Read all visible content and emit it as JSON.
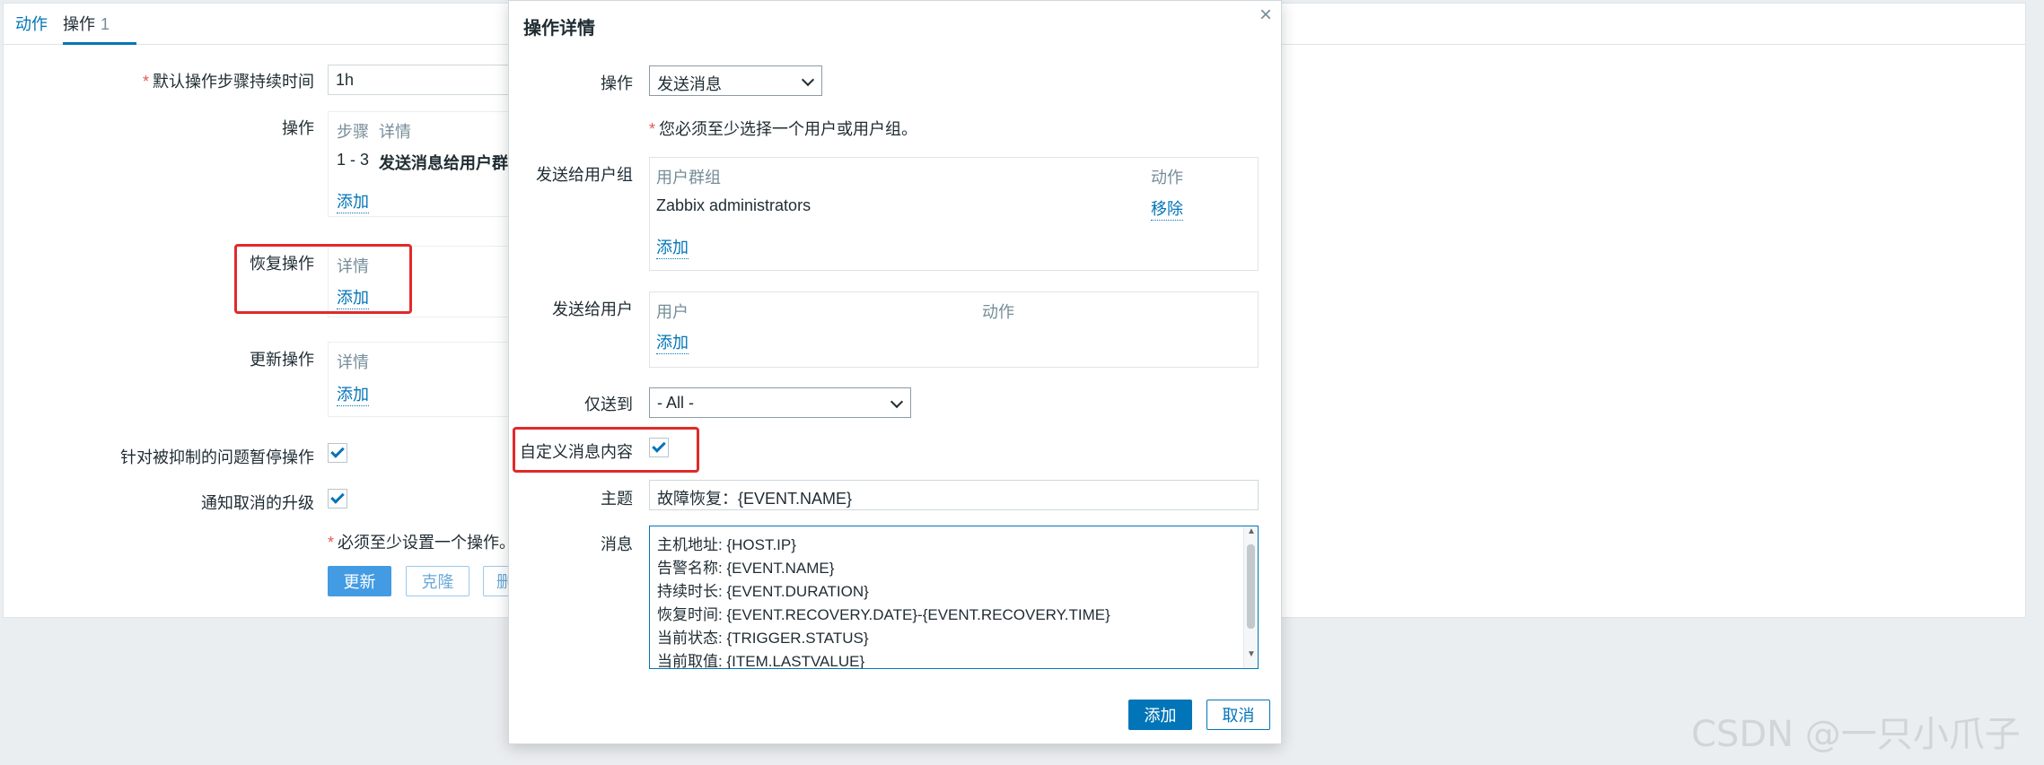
{
  "tabs": {
    "actions": "动作",
    "operations": "操作",
    "operations_count": "1"
  },
  "form": {
    "default_duration_label": "默认操作步骤持续时间",
    "default_duration_value": "1h",
    "operations_label": "操作",
    "operations_header_steps": "步骤",
    "operations_header_details": "详情",
    "operations_row_steps": "1 - 3",
    "operations_row_details": "发送消息给用户群",
    "add": "添加",
    "recovery_label": "恢复操作",
    "recovery_header_details": "详情",
    "update_label": "更新操作",
    "update_header_details": "详情",
    "pause_suppressed_label": "针对被抑制的问题暂停操作",
    "notify_cancelled_label": "通知取消的升级",
    "required_note": "必须至少设置一个操作。",
    "buttons": {
      "update": "更新",
      "clone": "克隆",
      "partial": "删"
    }
  },
  "modal": {
    "title": "操作详情",
    "close": "×",
    "operation_label": "操作",
    "operation_value": "发送消息",
    "required_hint": "您必须至少选择一个用户或用户组。",
    "send_groups_label": "发送给用户组",
    "groups_col_group": "用户群组",
    "groups_col_action": "动作",
    "group_name": "Zabbix administrators",
    "remove": "移除",
    "add": "添加",
    "send_users_label": "发送给用户",
    "users_col_user": "用户",
    "users_col_action": "动作",
    "send_only_label": "仅送到",
    "send_only_value": "- All -",
    "custom_message_label": "自定义消息内容",
    "subject_label": "主题",
    "subject_value": "故障恢复：{EVENT.NAME}",
    "message_label": "消息",
    "message_lines": [
      "主机地址: {HOST.IP}",
      "告警名称: {EVENT.NAME}",
      "持续时长: {EVENT.DURATION}",
      "恢复时间: {EVENT.RECOVERY.DATE}-{EVENT.RECOVERY.TIME}",
      "当前状态: {TRIGGER.STATUS}",
      "当前取值: {ITEM.LASTVALUE}"
    ],
    "buttons": {
      "add": "添加",
      "cancel": "取消"
    }
  },
  "watermark": "CSDN @一只小爪子",
  "colors": {
    "accent": "#0275b8",
    "highlight_box": "#e02a2a",
    "required": "#e45959"
  }
}
